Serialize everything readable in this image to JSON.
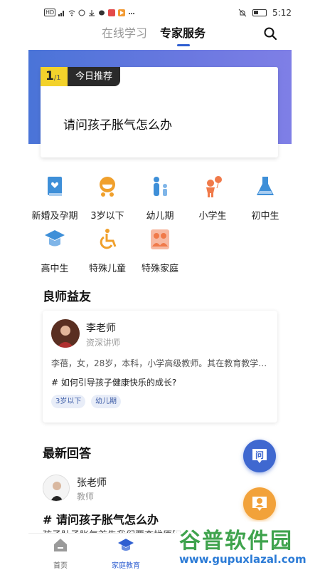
{
  "status_bar": {
    "time": "5:12",
    "network": "HD"
  },
  "top_nav": {
    "tabs": [
      {
        "label": "在线学习",
        "active": false
      },
      {
        "label": "专家服务",
        "active": true
      }
    ]
  },
  "recommend": {
    "page_current": "1",
    "page_total": "/1",
    "tag": "今日推荐",
    "question": "请问孩子胀气怎么办"
  },
  "categories": [
    {
      "label": "新婚及孕期",
      "icon": "book-heart-icon",
      "color": "#3e8fd8"
    },
    {
      "label": "3岁以下",
      "icon": "stroller-icon",
      "color": "#f0a02c"
    },
    {
      "label": "幼儿期",
      "icon": "parent-child-icon",
      "color": "#3e8fd8"
    },
    {
      "label": "小学生",
      "icon": "child-balloon-icon",
      "color": "#f07a4a"
    },
    {
      "label": "初中生",
      "icon": "flask-icon",
      "color": "#3e8fd8"
    },
    {
      "label": "高中生",
      "icon": "graduation-cap-icon",
      "color": "#3e8fd8"
    },
    {
      "label": "特殊儿童",
      "icon": "wheelchair-icon",
      "color": "#f0a02c"
    },
    {
      "label": "特殊家庭",
      "icon": "family-icon",
      "color": "#f07a4a"
    }
  ],
  "teachers_section": {
    "title": "良师益友",
    "card": {
      "name": "李老师",
      "title": "资深讲师",
      "description": "李蓓，女，28岁，本科，小学高级教师。其在教育教学…",
      "question": "# 如何引导孩子健康快乐的成长?",
      "tags": [
        "3岁以下",
        "幼儿期"
      ]
    }
  },
  "answers_section": {
    "title": "最新回答",
    "item": {
      "name": "张老师",
      "title": "教师",
      "question": "# 请问孩子胀气怎么办",
      "preview": "孩子肚子胀气首先我们要查找原因"
    }
  },
  "float_buttons": {
    "ask_label": "问"
  },
  "bottom_nav": [
    {
      "label": "首页",
      "icon": "home-icon",
      "active": false
    },
    {
      "label": "家庭教育",
      "icon": "graduation-cap-icon",
      "active": true
    }
  ],
  "watermark": {
    "brand": "谷普软件园",
    "url": "www.gupuxlazal.com"
  },
  "colors": {
    "accent": "#2f5fd1",
    "banner": "#5b78de",
    "yellow": "#f3d22b",
    "orange": "#f2a23a"
  }
}
